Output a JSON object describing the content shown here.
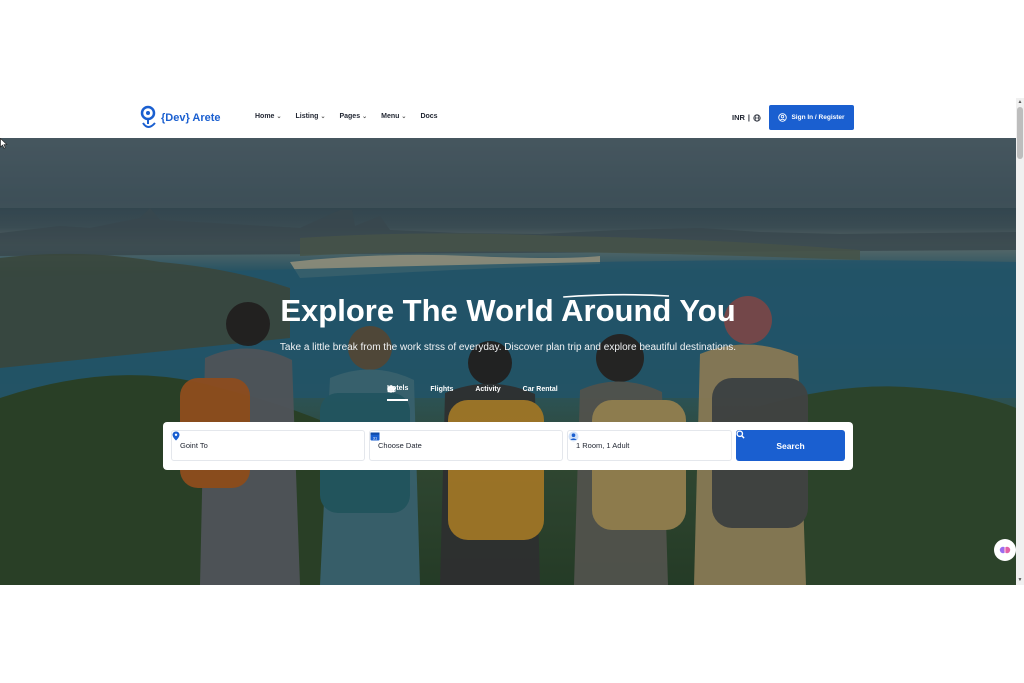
{
  "brand": {
    "name": "{Dev} Arete",
    "accent": "#1a5fd0"
  },
  "nav": {
    "items": [
      {
        "label": "Home",
        "dropdown": true
      },
      {
        "label": "Listing",
        "dropdown": true
      },
      {
        "label": "Pages",
        "dropdown": true
      },
      {
        "label": "Menu",
        "dropdown": true
      },
      {
        "label": "Docs",
        "dropdown": false
      }
    ],
    "currency": "INR",
    "separator": "|",
    "signin_label": "Sign In / Register"
  },
  "hero": {
    "title_part1": "Explore The World ",
    "title_em": "Around",
    "title_part2": " You",
    "subtitle": "Take a little break from the work strss of everyday. Discover plan trip and explore beautiful destinations."
  },
  "tabs": [
    {
      "label": "Hotels",
      "icon": "hotel-icon",
      "active": true
    },
    {
      "label": "Flights",
      "icon": "plane-icon",
      "active": false
    },
    {
      "label": "Activity",
      "icon": "globe-icon",
      "active": false
    },
    {
      "label": "Car Rental",
      "icon": "car-icon",
      "active": false
    }
  ],
  "search": {
    "destination": "Goint To",
    "date": "Choose Date",
    "guests": "1 Room, 1 Adult",
    "button_label": "Search"
  }
}
